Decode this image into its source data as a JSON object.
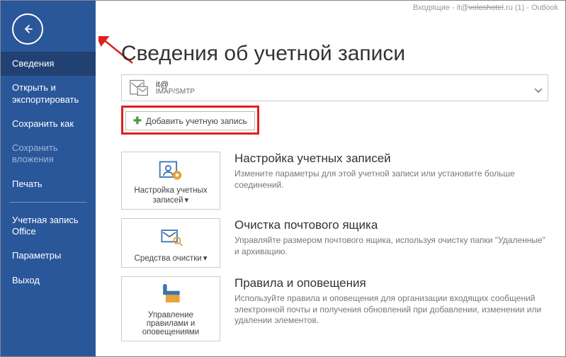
{
  "window": {
    "title_prefix": "Входящие - it@",
    "title_domain_masked": "voloshotel",
    "title_suffix": ".ru (1) - Outlook"
  },
  "sidebar": {
    "items": [
      {
        "label": "Сведения",
        "selected": true
      },
      {
        "label": "Открыть и экспортировать"
      },
      {
        "label": "Сохранить как"
      },
      {
        "label": "Сохранить вложения",
        "disabled": true
      },
      {
        "label": "Печать"
      }
    ],
    "bottom_items": [
      {
        "label": "Учетная запись Office"
      },
      {
        "label": "Параметры"
      },
      {
        "label": "Выход"
      }
    ]
  },
  "page": {
    "title": "Сведения об учетной записи",
    "account": {
      "email": "it@",
      "type": "IMAP/SMTP"
    },
    "add_account": "Добавить учетную запись",
    "sections": [
      {
        "tile": "Настройка учетных записей",
        "heading": "Настройка учетных записей",
        "desc": "Измените параметры для этой учетной записи или установите больше соединений."
      },
      {
        "tile": "Средства очистки",
        "heading": "Очистка почтового ящика",
        "desc": "Управляйте размером почтового ящика, используя очистку папки \"Удаленные\" и архивацию."
      },
      {
        "tile": "Управление правилами и оповещениями",
        "heading": "Правила и оповещения",
        "desc": "Используйте правила и оповещения для организации входящих сообщений электронной почты и получения обновлений при добавлении, изменении или удалении элементов."
      }
    ]
  }
}
